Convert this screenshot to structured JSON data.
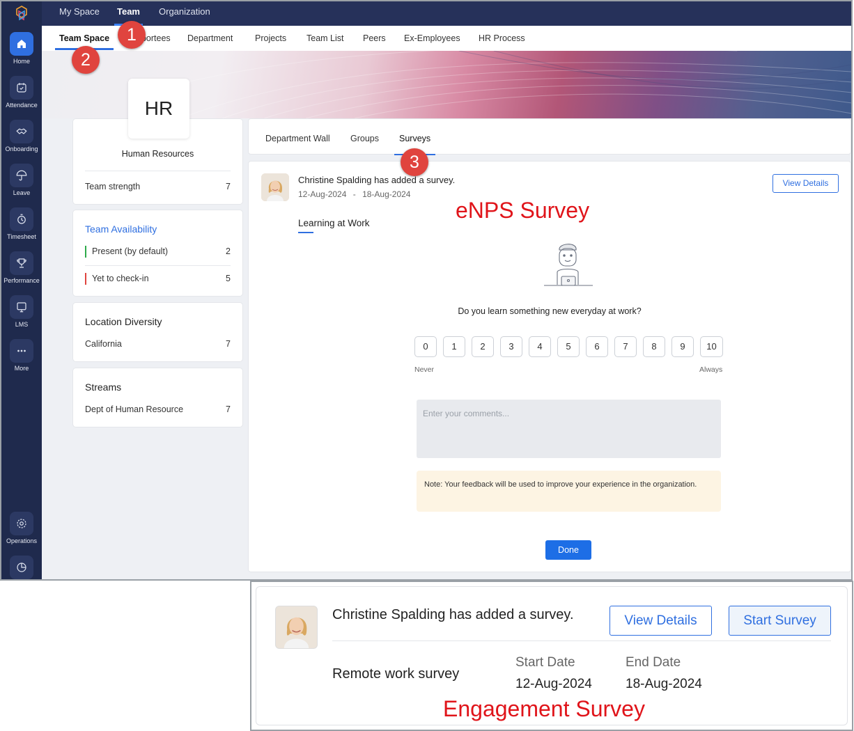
{
  "top_nav": {
    "items": [
      "My Space",
      "Team",
      "Organization"
    ],
    "active": "Team"
  },
  "sub_nav": {
    "items": [
      "Team Space",
      "Reportees",
      "Department",
      "Projects",
      "Team List",
      "Peers",
      "Ex-Employees",
      "HR Process"
    ],
    "active": "Team Space"
  },
  "sidebar": {
    "items": [
      {
        "label": "Home",
        "icon": "home-icon",
        "active": true
      },
      {
        "label": "Attendance",
        "icon": "calendar-check-icon"
      },
      {
        "label": "Onboarding",
        "icon": "handshake-icon"
      },
      {
        "label": "Leave",
        "icon": "umbrella-icon"
      },
      {
        "label": "Timesheet",
        "icon": "clock-icon"
      },
      {
        "label": "Performance",
        "icon": "trophy-icon"
      },
      {
        "label": "LMS",
        "icon": "monitor-icon"
      },
      {
        "label": "More",
        "icon": "more-icon"
      }
    ],
    "bottom_items": [
      {
        "label": "Operations",
        "icon": "gear-icon"
      },
      {
        "label": "",
        "icon": "pie-chart-icon"
      }
    ]
  },
  "department": {
    "badge": "HR",
    "name": "Human Resources",
    "team_strength_label": "Team strength",
    "team_strength_value": "7"
  },
  "availability": {
    "title": "Team Availability",
    "rows": [
      {
        "label": "Present (by default)",
        "value": "2",
        "color": "#2eaa4a"
      },
      {
        "label": "Yet to check-in",
        "value": "5",
        "color": "#e0443e"
      }
    ]
  },
  "location": {
    "title": "Location Diversity",
    "rows": [
      {
        "label": "California",
        "value": "7"
      }
    ]
  },
  "streams": {
    "title": "Streams",
    "rows": [
      {
        "label": "Dept of Human Resource",
        "value": "7"
      }
    ]
  },
  "wall_tabs": {
    "items": [
      "Department Wall",
      "Groups",
      "Surveys"
    ],
    "active": "Surveys"
  },
  "survey": {
    "posted_by": "Christine Spalding has added a survey.",
    "start_date": "12-Aug-2024",
    "date_separator": "-",
    "end_date": "18-Aug-2024",
    "view_details": "View Details",
    "title": "Learning at Work",
    "question": "Do you learn something new everyday at work?",
    "scale": [
      "0",
      "1",
      "2",
      "3",
      "4",
      "5",
      "6",
      "7",
      "8",
      "9",
      "10"
    ],
    "scale_min_label": "Never",
    "scale_max_label": "Always",
    "comment_placeholder": "Enter your comments...",
    "note": "Note: Your feedback will be used to improve your experience in the organization.",
    "done": "Done"
  },
  "annotations": {
    "marker_1": "1",
    "marker_2": "2",
    "marker_3": "3",
    "enps_label": "eNPS Survey",
    "engagement_label": "Engagement Survey"
  },
  "engagement": {
    "posted_by": "Christine Spalding has added a survey.",
    "view_details": "View Details",
    "start_survey": "Start Survey",
    "survey_name": "Remote work survey",
    "start_date_label": "Start Date",
    "start_date": "12-Aug-2024",
    "end_date_label": "End Date",
    "end_date": "18-Aug-2024"
  },
  "colors": {
    "sidebar_bg": "#1f2a4d",
    "topbar_bg": "#26315a",
    "accent": "#2f6fe0",
    "done_button": "#1d6ee6",
    "annotation_red": "#e0141a"
  }
}
